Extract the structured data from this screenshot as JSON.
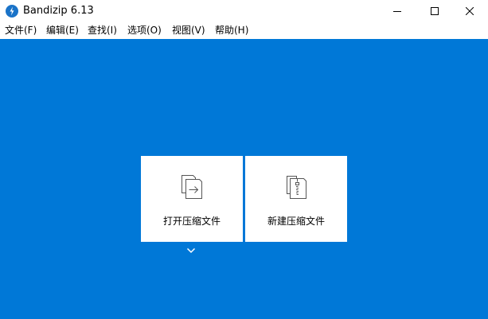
{
  "window": {
    "title": "Bandizip 6.13",
    "icon": "bandizip-logo-icon",
    "controls": [
      "minimize-icon",
      "maximize-icon",
      "close-icon"
    ]
  },
  "menubar": {
    "items": [
      {
        "label": "文件(F)"
      },
      {
        "label": "编辑(E)"
      },
      {
        "label": "查找(I)"
      },
      {
        "label": "选项(O)"
      },
      {
        "label": "视图(V)"
      },
      {
        "label": "帮助(H)"
      }
    ]
  },
  "main": {
    "background": "#0078d7",
    "actions": [
      {
        "label": "打开压缩文件",
        "icon": "open-archive-icon"
      },
      {
        "label": "新建压缩文件",
        "icon": "new-archive-icon"
      }
    ],
    "dropdown_icon": "chevron-down-icon"
  },
  "colors": {
    "accent": "#0078d7",
    "card": "#ffffff",
    "icon_stroke": "#555555"
  }
}
